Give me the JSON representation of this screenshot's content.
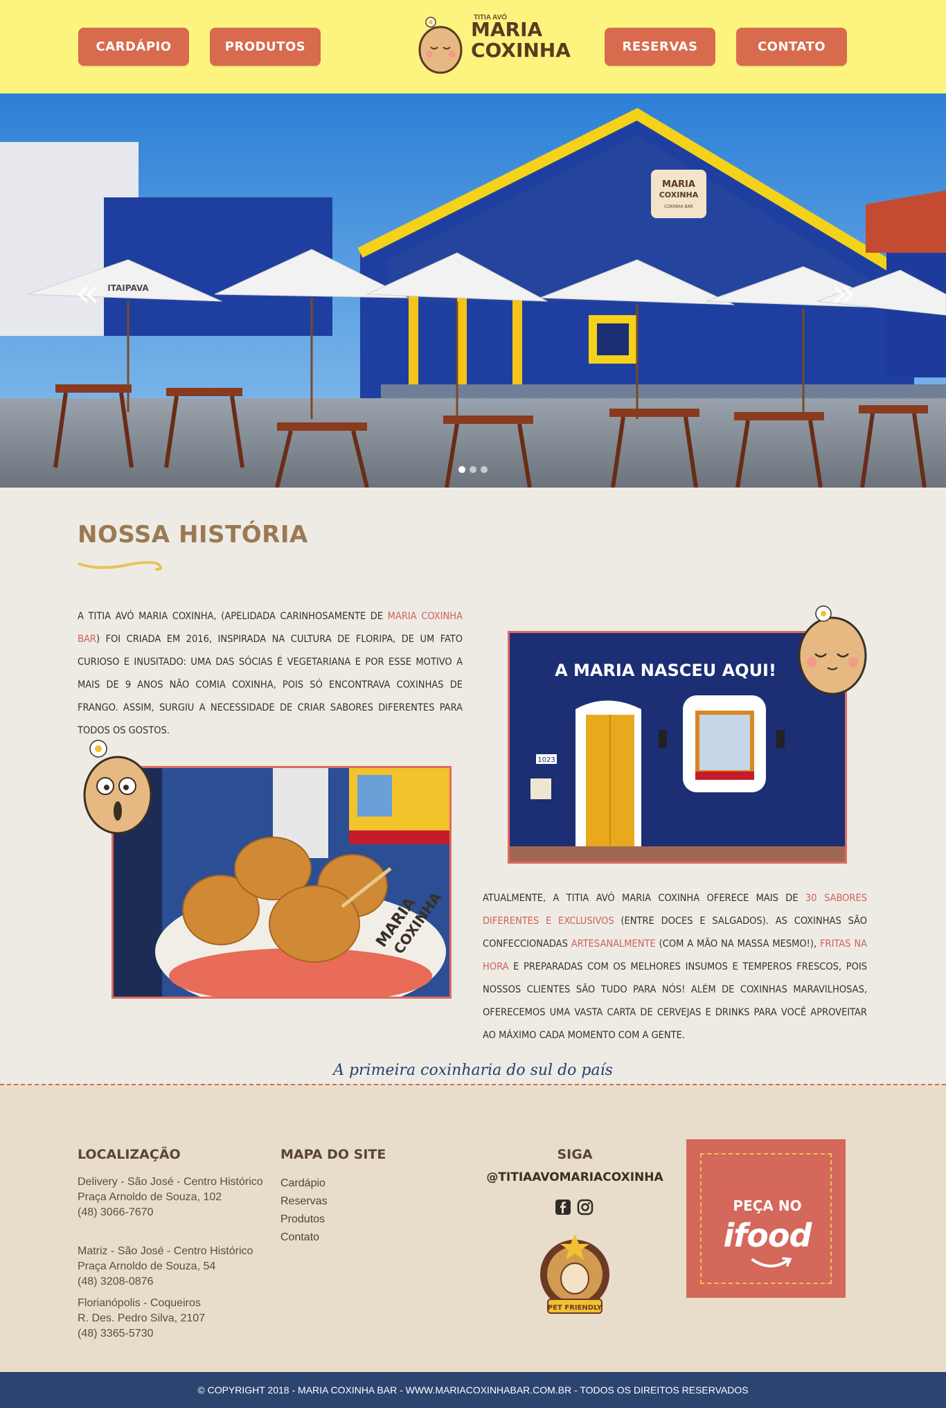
{
  "nav": {
    "items": [
      {
        "label": "Cardápio"
      },
      {
        "label": "Produtos"
      },
      {
        "label": "Reservas"
      },
      {
        "label": "Contato"
      }
    ]
  },
  "logo": {
    "small": "TITIA AVÓ",
    "line1": "MARIA",
    "line2": "COXINHA"
  },
  "hero": {
    "slides": 3,
    "active_slide": 1,
    "umbrella_brand": "ITAIPAVA",
    "sign_line1": "MARIA",
    "sign_line2": "COXINHA",
    "sign_line3": "COXINHA BAR"
  },
  "history": {
    "title": "Nossa História",
    "para1": {
      "p1": "A Titia Avó Maria Coxinha, (apelidada carinhosamente de ",
      "h1": "Maria Coxinha Bar",
      "p2": ") foi criada em 2016, inspirada na cultura de Floripa, de um fato curioso e inusitado: uma das sócias é vegetariana e por esse motivo a mais de 9 anos não comia coxinha, pois só encontrava coxinhas de frango. Assim, surgiu a necessidade de criar sabores diferentes para todos os gostos."
    },
    "photo2_caption": "A MARIA NASCEU AQUI!",
    "house_number": "1023",
    "basket_brand_line1": "MARIA",
    "basket_brand_line2": "COXINHA",
    "para2": {
      "p1": "Atualmente, a Titia Avó Maria Coxinha oferece mais de ",
      "h1": "30 sabores diferentes e exclusivos",
      "p2": " (entre doces e salgados). As coxinhas são confeccionadas ",
      "h2": "artesanalmente",
      "p3": " (com a mão na massa mesmo!), ",
      "h3": "fritas na hora",
      "p4": " e preparadas com os melhores insumos e temperos frescos, pois nossos clientes são tudo para nós! Além de coxinhas maravilhosas, oferecemos uma vasta carta de cervejas e drinks para você aproveitar ao máximo cada momento com a gente."
    },
    "tagline": "A primeira coxinharia do sul do país"
  },
  "footer": {
    "location_title": "Localização",
    "locations": [
      {
        "name": "Delivery - São José - Centro Histórico",
        "address": "Praça Arnoldo de Souza, 102",
        "phone": "(48) 3066-7670"
      },
      {
        "name": "Matriz - São José - Centro Histórico",
        "address": "Praça Arnoldo de Souza, 54",
        "phone": "(48) 3208-0876"
      },
      {
        "name": "Florianópolis - Coqueiros",
        "address": "R. Des. Pedro Silva, 2107",
        "phone": "(48) 3365-5730"
      }
    ],
    "sitemap_title": "Mapa do Site",
    "sitemap": [
      "Cardápio",
      "Reservas",
      "Produtos",
      "Contato"
    ],
    "follow_title": "Siga",
    "handle": "@titiaavomariacoxinha",
    "pet_friendly": "PET FRIENDLY",
    "ifood_order": "Peça no",
    "ifood_brand": "ifood",
    "copyright": "© Copyright 2018 - Maria Coxinha Bar - www.mariacoxinhabar.com.br - Todos os direitos reservados"
  },
  "colors": {
    "header_bg": "#fdf47f",
    "nav_button": "#d86a4d",
    "title": "#9a7a52",
    "highlight": "#d0605a",
    "footer_bg": "#e8ddca",
    "copyright_bg": "#2c4470",
    "ifood_bg": "#d4685a"
  }
}
